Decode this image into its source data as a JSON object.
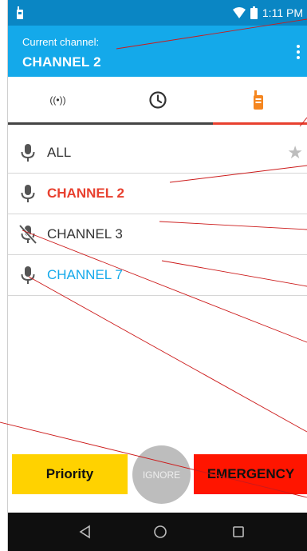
{
  "status_bar": {
    "time": "1:11 PM",
    "icons": [
      "walkie-talkie-icon",
      "wifi-icon",
      "battery-icon"
    ]
  },
  "header": {
    "subtitle": "Current channel:",
    "channel": "CHANNEL 2",
    "menu_icon": "more-vert-icon"
  },
  "tabs": [
    {
      "icon": "broadcast-icon",
      "label": "((•))",
      "active": false
    },
    {
      "icon": "clock-icon",
      "active": false
    },
    {
      "icon": "radio-icon",
      "active": true
    }
  ],
  "channels": [
    {
      "label": "ALL",
      "state": "normal",
      "favorite": true
    },
    {
      "label": "CHANNEL 2",
      "state": "current"
    },
    {
      "label": "CHANNEL 3",
      "state": "muted"
    },
    {
      "label": "CHANNEL 7",
      "state": "listening"
    }
  ],
  "buttons": {
    "priority": "Priority",
    "ignore": "IGNORE",
    "emergency": "EMERGENCY"
  },
  "nav": [
    "back-icon",
    "home-icon",
    "recents-icon"
  ],
  "colors": {
    "status_bar": "#0a86c4",
    "header": "#14a9ea",
    "accent": "#e8402f",
    "current_channel": "#e8402f",
    "listening_channel": "#14a9ea",
    "radio_tab": "#f5861f",
    "priority": "#ffd200",
    "emergency": "#ff1500",
    "ignore": "#bdbdbd",
    "annotation_lines": "#cc1a1a"
  }
}
